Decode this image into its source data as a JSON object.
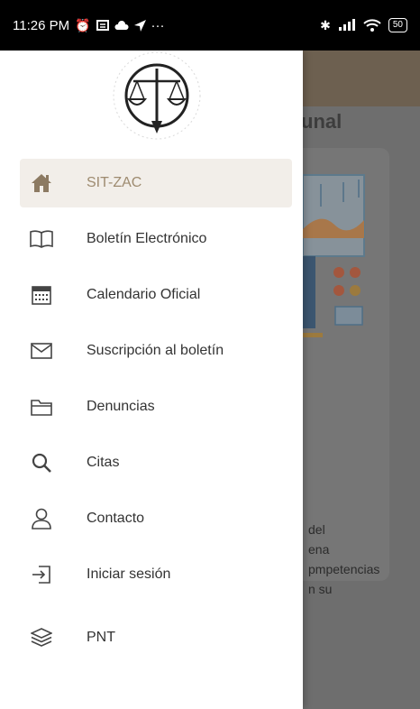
{
  "status_bar": {
    "time": "11:26 PM",
    "more": "···",
    "battery": "50"
  },
  "background": {
    "partial_title": "unal",
    "partial_text": [
      "del",
      "ena",
      "pmpetencias",
      "n su"
    ]
  },
  "drawer": {
    "logo_icon": "scales-of-justice-seal",
    "menu": [
      {
        "label": "SIT-ZAC",
        "icon": "home-icon",
        "active": true
      },
      {
        "label": "Boletín Electrónico",
        "icon": "book-icon"
      },
      {
        "label": "Calendario Oficial",
        "icon": "calendar-icon"
      },
      {
        "label": "Suscripción al boletín",
        "icon": "envelope-icon"
      },
      {
        "label": "Denuncias",
        "icon": "folder-icon"
      },
      {
        "label": "Citas",
        "icon": "search-icon"
      },
      {
        "label": "Contacto",
        "icon": "person-icon"
      },
      {
        "label": "Iniciar sesión",
        "icon": "login-icon"
      },
      {
        "label": "PNT",
        "icon": "layers-icon"
      }
    ]
  },
  "colors": {
    "accent": "#9e8b70",
    "active_bg": "#f2eee9",
    "text": "#333333",
    "scrim": "#6e6e6e"
  }
}
